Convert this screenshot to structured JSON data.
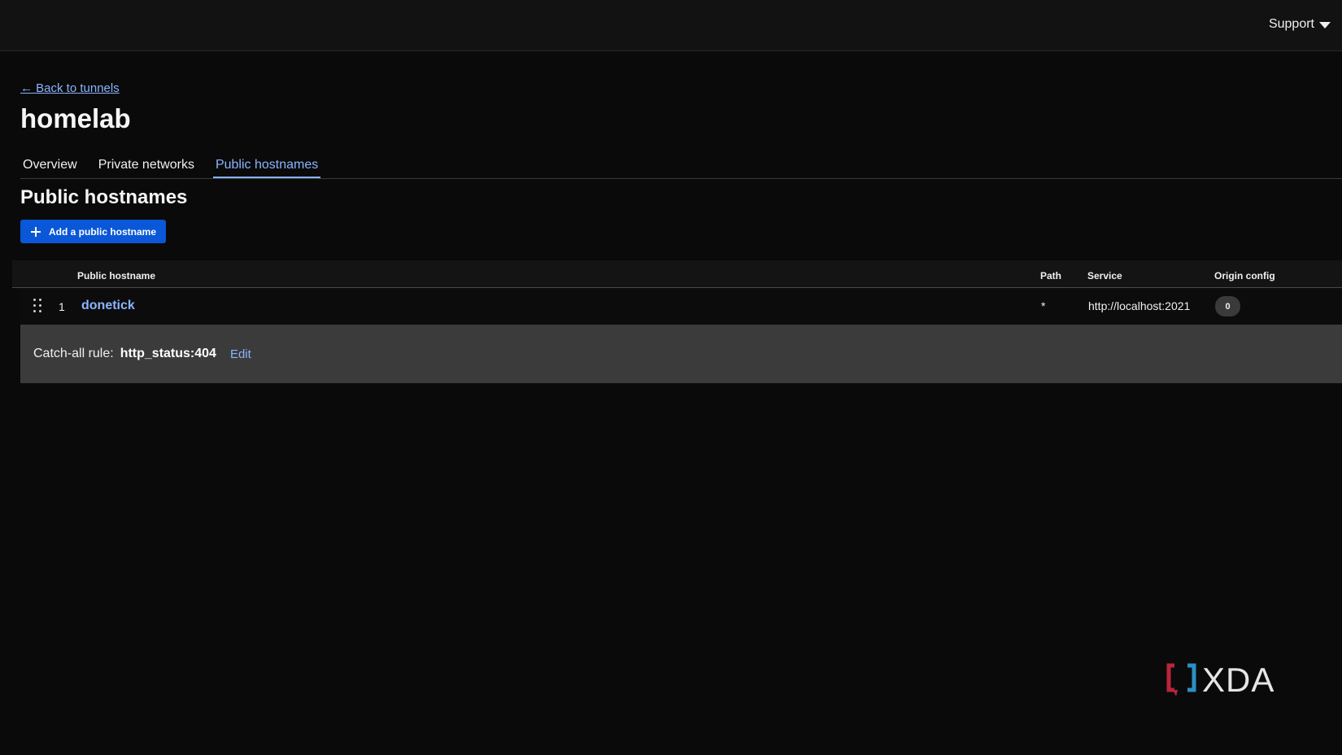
{
  "header": {
    "support_label": "Support"
  },
  "nav": {
    "back_label": "← Back to tunnels"
  },
  "tunnel": {
    "name": "homelab"
  },
  "tabs": [
    {
      "label": "Overview",
      "active": false
    },
    {
      "label": "Private networks",
      "active": false
    },
    {
      "label": "Public hostnames",
      "active": true
    }
  ],
  "section": {
    "title": "Public hostnames",
    "add_button_label": "Add a public hostname"
  },
  "table": {
    "columns": {
      "hostname": "Public hostname",
      "path": "Path",
      "service": "Service",
      "origin": "Origin config"
    },
    "rows": [
      {
        "index": "1",
        "hostname": "donetick",
        "path": "*",
        "service": "http://localhost:2021",
        "origin_count": "0"
      }
    ]
  },
  "catch_all": {
    "label": "Catch-all rule:",
    "value": "http_status:404",
    "edit_label": "Edit"
  },
  "watermark": {
    "text": "XDA"
  },
  "colors": {
    "accent_link": "#8ab4ff",
    "primary_button": "#0a57d8",
    "background": "#0a0a0a"
  }
}
